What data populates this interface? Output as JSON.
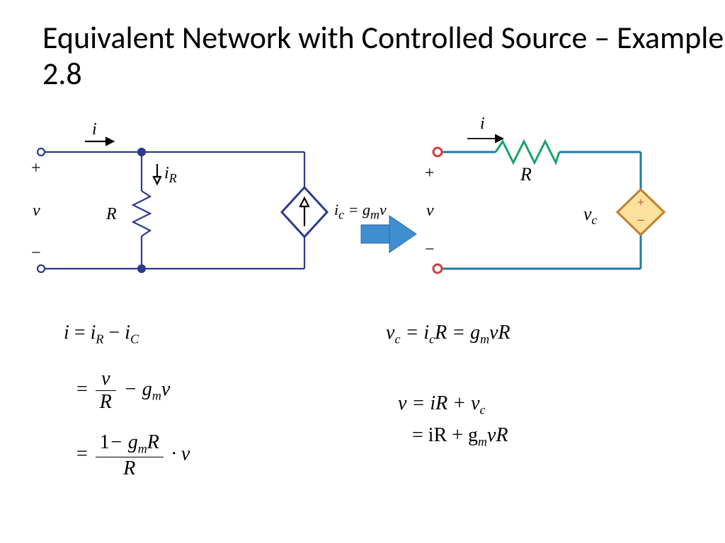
{
  "title": "Equivalent Network with Controlled Source – Example 2.8",
  "left_circuit": {
    "current_top": "i",
    "port_plus": "+",
    "port_voltage": "v",
    "port_minus": "−",
    "branch_current": "i",
    "branch_current_sub": "R",
    "resistor": "R",
    "source_label_prefix": "i",
    "source_label_sub": "c",
    "source_label_eq": "= g",
    "source_label_sub2": "m",
    "source_label_v": "v"
  },
  "right_circuit": {
    "current_top": "i",
    "port_plus": "+",
    "port_voltage": "v",
    "port_minus": "−",
    "resistor": "R",
    "dep_plus": "+",
    "dep_minus": "−",
    "vc_label": "v",
    "vc_sub": "c"
  },
  "eqs": {
    "eq1a": {
      "i": "i",
      "eq": " = ",
      "iR": "i",
      "subR": "R",
      "minus": " − ",
      "iC": "i",
      "subC": "C"
    },
    "eq1b": {
      "eq": "= ",
      "v": "v",
      "R": "R",
      "minus": " − g",
      "m": "m",
      "v2": "v"
    },
    "eq1c": {
      "eq": "= ",
      "num1": "1",
      "minus": "− g",
      "m": "m",
      "R": "R",
      "den": "R",
      "dot": " · v"
    },
    "eq2": {
      "vc": "v",
      "c": "c",
      "eq": " = i",
      "c2": "c",
      "R": "R = g",
      "m": "m",
      "vR": "vR"
    },
    "eq3a": {
      "v": "v = iR + v",
      "c": "c"
    },
    "eq3b": {
      "eq": "= iR + g",
      "m": "m",
      "vR": "vR"
    }
  }
}
